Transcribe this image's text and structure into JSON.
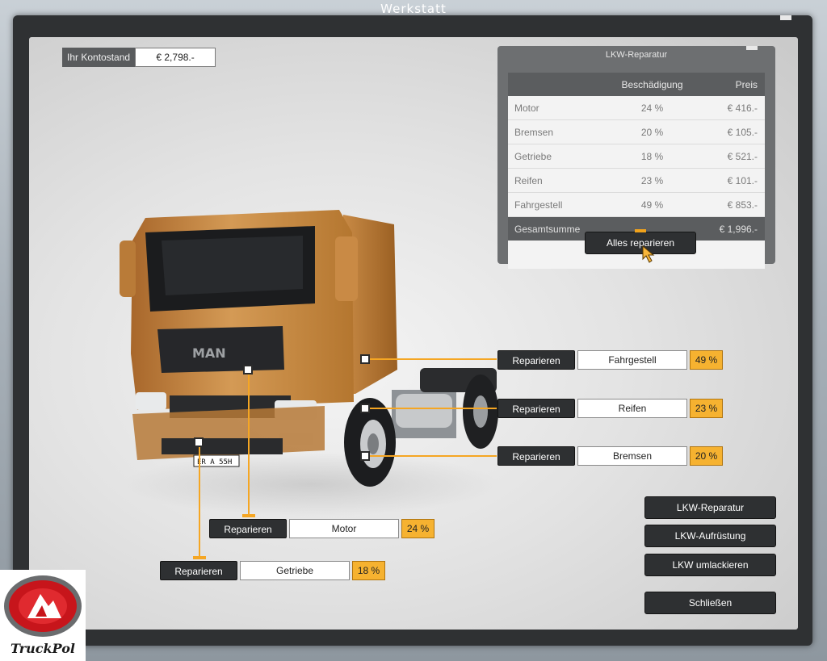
{
  "window": {
    "title": "Werkstatt"
  },
  "balance": {
    "label": "Ihr Kontostand",
    "value": "€ 2,798.-"
  },
  "repair_panel": {
    "title": "LKW-Reparatur",
    "headers": {
      "damage": "Beschädigung",
      "price": "Preis"
    },
    "rows": [
      {
        "part": "Motor",
        "damage": "24 %",
        "price": "€ 416.-"
      },
      {
        "part": "Bremsen",
        "damage": "20 %",
        "price": "€ 105.-"
      },
      {
        "part": "Getriebe",
        "damage": "18 %",
        "price": "€ 521.-"
      },
      {
        "part": "Reifen",
        "damage": "23 %",
        "price": "€ 101.-"
      },
      {
        "part": "Fahrgestell",
        "damage": "49 %",
        "price": "€ 853.-"
      }
    ],
    "total": {
      "label": "Gesamtsumme",
      "value": "€ 1,996.-"
    },
    "repair_all_label": "Alles reparieren"
  },
  "components": [
    {
      "button": "Reparieren",
      "name": "Fahrgestell",
      "damage": "49 %"
    },
    {
      "button": "Reparieren",
      "name": "Reifen",
      "damage": "23 %"
    },
    {
      "button": "Reparieren",
      "name": "Bremsen",
      "damage": "20 %"
    },
    {
      "button": "Reparieren",
      "name": "Motor",
      "damage": "24 %"
    },
    {
      "button": "Reparieren",
      "name": "Getriebe",
      "damage": "18 %"
    }
  ],
  "truck": {
    "brand": "MAN",
    "plate": "ER A 55H",
    "color": "#c98a45"
  },
  "side_buttons": {
    "repair": "LKW-Reparatur",
    "upgrade": "LKW-Aufrüstung",
    "repaint": "LKW umlackieren",
    "close": "Schließen"
  },
  "logo": {
    "text": "TruckPol"
  },
  "colors": {
    "accent": "#f5a623",
    "button": "#2e3032",
    "panel": "#6d6f71"
  }
}
